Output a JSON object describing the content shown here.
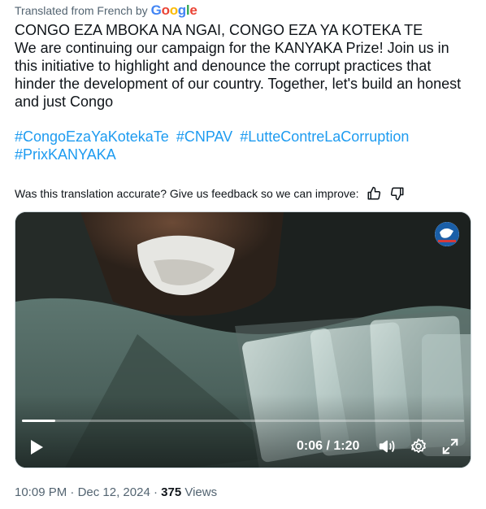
{
  "translation": {
    "prefix": "Translated from French by",
    "provider": [
      "G",
      "o",
      "o",
      "g",
      "l",
      "e"
    ]
  },
  "tweet": {
    "line1": "CONGO EZA MBOKA NA NGAI, CONGO EZA YA KOTEKA TE",
    "body": "We are continuing our campaign for the KANYAKA Prize! Join us in this initiative to highlight and denounce the corrupt practices that hinder the development of our country. Together, let's build an honest and just Congo",
    "hashtags": [
      "#CongoEzaYaKotekaTe",
      "#CNPAV",
      "#LutteContreLaCorruption",
      "#PrixKANYAKA"
    ]
  },
  "feedback": {
    "question": "Was this translation accurate? Give us feedback so we can improve:",
    "up_icon": "thumbs-up-icon",
    "down_icon": "thumbs-down-icon"
  },
  "video": {
    "current_time": "0:06",
    "separator": "/",
    "duration": "1:20",
    "progress": 0.075,
    "icons": [
      "play-icon",
      "volume-icon",
      "settings-icon",
      "fullscreen-icon"
    ]
  },
  "meta": {
    "time": "10:09 PM",
    "date": "Dec 12, 2024",
    "views_count": "375",
    "views_label": "Views",
    "dot": "·"
  },
  "colors": {
    "link": "#1d9bf0",
    "secondary_text": "#536471",
    "primary_text": "#0f1419"
  }
}
